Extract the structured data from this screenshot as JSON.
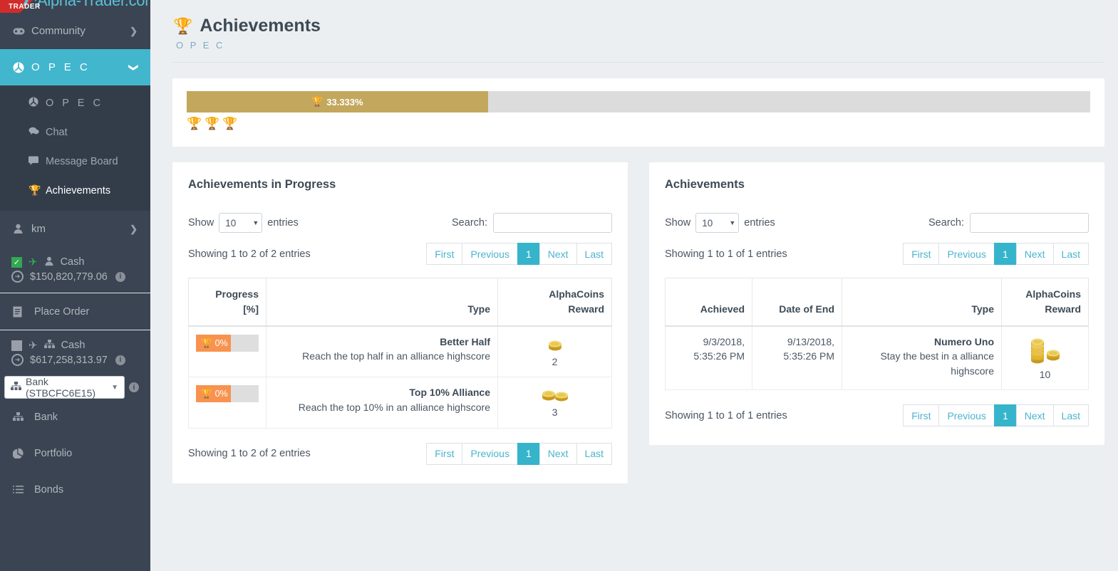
{
  "brand": {
    "name": "Alpha-Trader.com",
    "ribbon_label": "TRADER"
  },
  "sidebar": {
    "community": {
      "label": "Community",
      "icon": "gamepad-icon",
      "chevron": "❯"
    },
    "opec": {
      "label": "O P E C",
      "icon": "alliance-icon",
      "chevron": "❯"
    },
    "submenu": [
      {
        "label": "O P E C",
        "icon": "alliance-icon"
      },
      {
        "label": "Chat",
        "icon": "chat-icon"
      },
      {
        "label": "Message Board",
        "icon": "message-board-icon"
      },
      {
        "label": "Achievements",
        "icon": "trophy-icon"
      }
    ],
    "user": {
      "label": "km",
      "icon": "user-icon",
      "chevron": "❯"
    },
    "cash_user": {
      "label": "Cash",
      "amount": "$150,820,779.06",
      "info": "i"
    },
    "place_order": {
      "label": "Place Order",
      "icon": "document-icon"
    },
    "cash_bank": {
      "label": "Cash",
      "amount": "$617,258,313.97",
      "info": "i"
    },
    "bank_select": {
      "value": "Bank (STBCFC6E15)",
      "icon": "sitemap-icon",
      "caret": "▼",
      "info": "i"
    },
    "links": [
      {
        "label": "Bank",
        "icon": "sitemap-icon"
      },
      {
        "label": "Portfolio",
        "icon": "pie-chart-icon"
      },
      {
        "label": "Bonds",
        "icon": "list-icon"
      }
    ]
  },
  "page": {
    "title": "Achievements",
    "title_icon": "trophy-icon",
    "subtitle": "O P E C"
  },
  "overall_progress": {
    "percent_label": "33.333%",
    "percent_value": 33.333,
    "fill_color": "#c3a75d",
    "track_color": "#dcdcdc",
    "trophies": [
      {
        "name": "trophy-icon",
        "color": "#f0762b"
      },
      {
        "name": "trophy-icon",
        "color": "#f0762b"
      },
      {
        "name": "trophy-icon",
        "color": "#46c68c"
      }
    ]
  },
  "panel_progress": {
    "title": "Achievements in Progress",
    "show_label": "Show",
    "entries_label": "entries",
    "page_length": "10",
    "search_label": "Search:",
    "search_value": "",
    "search_placeholder": "",
    "info_top": "Showing 1 to 2 of 2 entries",
    "info_bottom": "Showing 1 to 2 of 2 entries",
    "pager": [
      "First",
      "Previous",
      "1",
      "Next",
      "Last"
    ],
    "current_page": "1",
    "columns": [
      "Progress [%]",
      "Type",
      "AlphaCoins Reward"
    ],
    "columns_split": [
      [
        "Progress",
        "[%]"
      ],
      [
        "",
        "Type"
      ],
      [
        "AlphaCoins",
        "Reward"
      ]
    ],
    "rows": [
      {
        "progress_label": "0%",
        "progress_value": 0,
        "type_name": "Better Half",
        "type_desc": "Reach the top half in an alliance highscore",
        "reward": "2",
        "reward_coins": 1
      },
      {
        "progress_label": "0%",
        "progress_value": 0,
        "type_name": "Top 10% Alliance",
        "type_desc": "Reach the top 10% in an alliance highscore",
        "reward": "3",
        "reward_coins": 2
      }
    ]
  },
  "panel_achieved": {
    "title": "Achievements",
    "show_label": "Show",
    "entries_label": "entries",
    "page_length": "10",
    "search_label": "Search:",
    "search_value": "",
    "search_placeholder": "",
    "info_top": "Showing 1 to 1 of 1 entries",
    "info_bottom": "Showing 1 to 1 of 1 entries",
    "pager": [
      "First",
      "Previous",
      "1",
      "Next",
      "Last"
    ],
    "current_page": "1",
    "columns": [
      "Achieved",
      "Date of End",
      "Type",
      "AlphaCoins Reward"
    ],
    "rows": [
      {
        "achieved": "9/3/2018, 5:35:26 PM",
        "achieved_l1": "9/3/2018,",
        "achieved_l2": "5:35:26 PM",
        "date_end": "9/13/2018, 5:35:26 PM",
        "date_end_l1": "9/13/2018,",
        "date_end_l2": "5:35:26 PM",
        "type_name": "Numero Uno",
        "type_desc": "Stay the best in a alliance highscore",
        "reward": "10",
        "reward_coins": 3
      }
    ]
  },
  "colors": {
    "accent": "#42b6cd",
    "sidebar_bg": "#3a4452",
    "submenu_bg": "#333d4a",
    "progress_orange": "#f7934f",
    "gold": "#c3a75d"
  }
}
